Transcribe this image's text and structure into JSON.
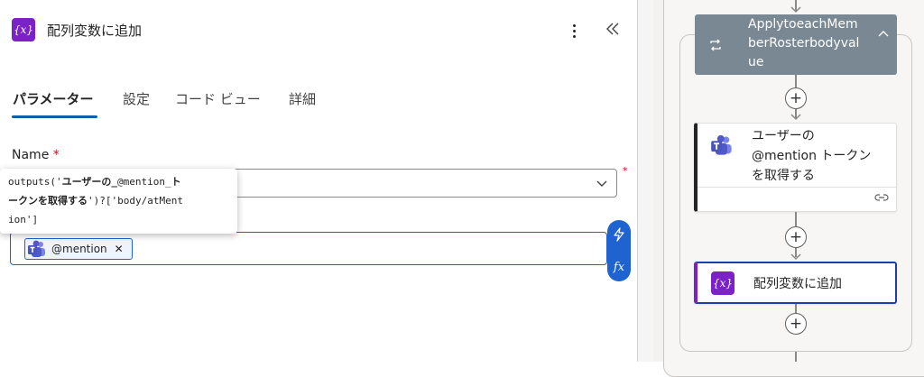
{
  "panel": {
    "title": "配列変数に追加",
    "badge_icon_text": "{x}"
  },
  "tabs": [
    "パラメーター",
    "設定",
    "コード ビュー",
    "詳細"
  ],
  "form": {
    "name_label": "Name",
    "required_mark": "*",
    "value_token": "@mention",
    "token_remove": "✕",
    "fx_label": "fx"
  },
  "tooltip": {
    "line1_prefix": "outputs('",
    "line1_bold": "ユーザーの_",
    "line1_mid": "@mention_",
    "line1_bold2": "ト",
    "line2_bold": "ークンを取得する",
    "line2_rest": "')?['body/atMent",
    "line3": "ion']"
  },
  "flow": {
    "loop_title": "ApplytoeachMemberRosterbodyvalue",
    "loop_title_lines": [
      "ApplytoeachMem",
      "berRosterbodyval",
      "ue"
    ],
    "action1_lines": [
      "ユーザーの",
      "@mention トークン",
      "を取得する"
    ],
    "action2_title": "配列変数に追加",
    "badge_icon_text": "{x}"
  },
  "colors": {
    "accent": "#1f63d0",
    "variable_purple": "#7a22c8",
    "loop_header": "#7a8894",
    "required": "#c50f1f"
  }
}
